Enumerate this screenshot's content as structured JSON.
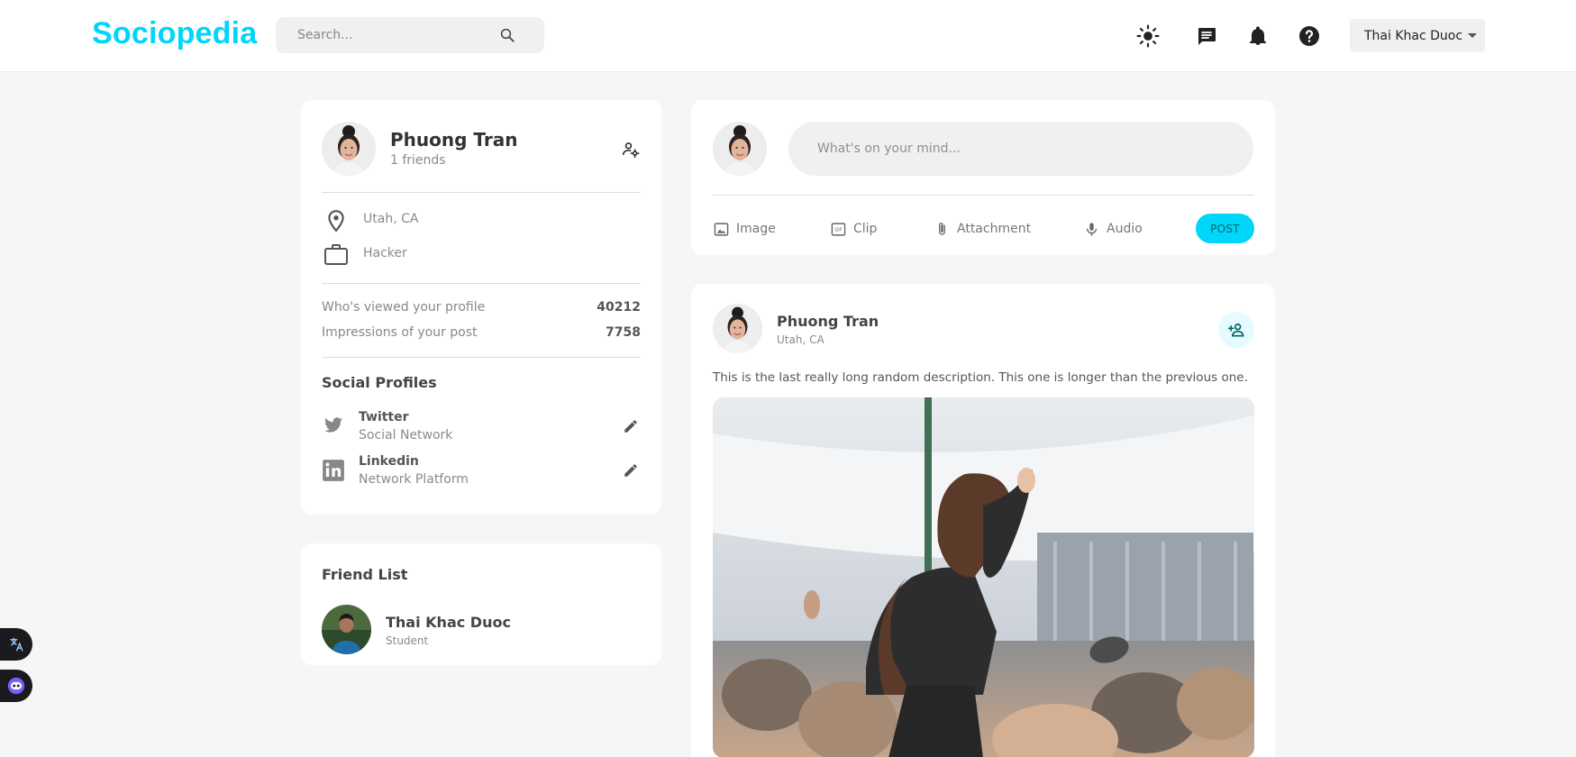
{
  "brand": "Sociopedia",
  "search": {
    "placeholder": "Search..."
  },
  "nav": {
    "icons": [
      "sun-icon",
      "message-icon",
      "bell-icon",
      "help-icon"
    ],
    "user_name": "Thai Khac Duoc"
  },
  "profile": {
    "name": "Phuong Tran",
    "friends": "1 friends",
    "location": "Utah, CA",
    "occupation": "Hacker",
    "stats": [
      {
        "label": "Who's viewed your profile",
        "value": "40212"
      },
      {
        "label": "Impressions of your post",
        "value": "7758"
      }
    ],
    "social_title": "Social Profiles",
    "socials": [
      {
        "name": "Twitter",
        "type": "Social Network"
      },
      {
        "name": "Linkedin",
        "type": "Network Platform"
      }
    ]
  },
  "friend_list": {
    "title": "Friend List",
    "friends": [
      {
        "name": "Thai Khac Duoc",
        "role": "Student"
      }
    ]
  },
  "composer": {
    "placeholder": "What's on your mind...",
    "actions": [
      "Image",
      "Clip",
      "Attachment",
      "Audio"
    ],
    "post_label": "POST"
  },
  "post": {
    "author": "Phuong Tran",
    "location": "Utah, CA",
    "description": "This is the last really long random description. This one is longer than the previous one."
  },
  "colors": {
    "brand": "#00d5fa",
    "background": "#f6f6f6",
    "card": "#ffffff"
  }
}
